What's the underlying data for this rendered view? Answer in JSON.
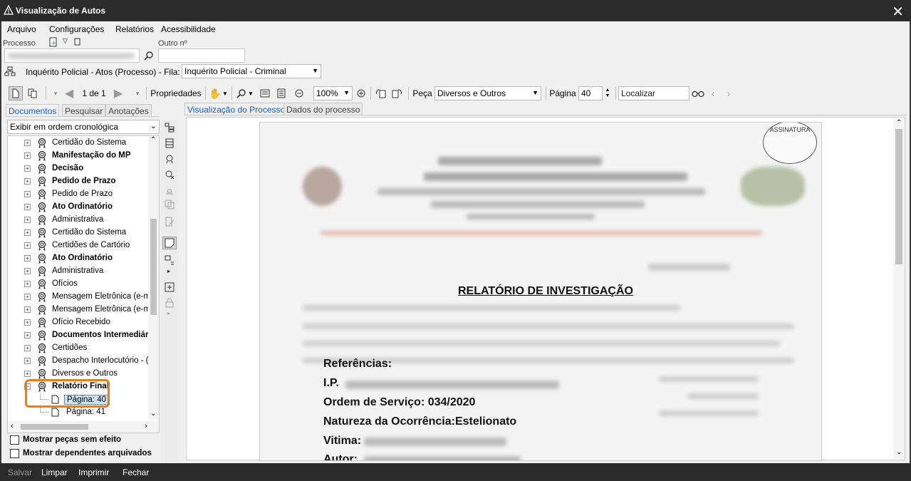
{
  "window": {
    "title": "Visualização de Autos",
    "close_glyph": "✕"
  },
  "menu": {
    "items": [
      "Arquivo",
      "Configurações",
      "Relatórios",
      "Acessibilidade"
    ]
  },
  "process": {
    "label": "Processo",
    "number": "",
    "other_label": "Outro nº",
    "other_value": ""
  },
  "queue": {
    "text": "Inquérito Policial - Atos (Processo) - Fila:",
    "selected": "Inquérito Policial - Criminal"
  },
  "toolbar": {
    "page_counter": "1 de 1",
    "properties": "Propriedades",
    "zoom": "100%",
    "piece_label": "Peça",
    "piece_value": "Diversos e Outros",
    "page_label": "Página",
    "page_value": "40",
    "search_placeholder": "Localizar"
  },
  "left_tabs": [
    "Documentos",
    "Pesquisar",
    "Anotações"
  ],
  "order_select": "Exibir em ordem cronológica",
  "tree": [
    {
      "label": "Certidão do Sistema",
      "bold": false
    },
    {
      "label": "Manifestação do MP",
      "bold": true
    },
    {
      "label": "Decisão",
      "bold": true
    },
    {
      "label": "Pedido de Prazo",
      "bold": true
    },
    {
      "label": "Pedido de Prazo",
      "bold": false
    },
    {
      "label": "Ato Ordinatório",
      "bold": true
    },
    {
      "label": "Administrativa",
      "bold": false
    },
    {
      "label": "Certidão do Sistema",
      "bold": false
    },
    {
      "label": "Certidões de Cartório",
      "bold": false
    },
    {
      "label": "Ato Ordinatório",
      "bold": true
    },
    {
      "label": "Administrativa",
      "bold": false
    },
    {
      "label": "Ofícios",
      "bold": false
    },
    {
      "label": "Mensagem Eletrônica  (e-m",
      "bold": false
    },
    {
      "label": "Mensagem Eletrônica  (e-m",
      "bold": false
    },
    {
      "label": "Ofício Recebido",
      "bold": false
    },
    {
      "label": "Documentos Intermediári",
      "bold": true
    },
    {
      "label": "Certidões",
      "bold": false
    },
    {
      "label": "Despacho Interlocutório - (",
      "bold": false
    },
    {
      "label": "Diversos e Outros",
      "bold": false
    },
    {
      "label": "Relatório Final",
      "bold": true,
      "expanded": true
    }
  ],
  "tree_children": [
    "Página: 40",
    "Página: 41"
  ],
  "checkboxes": [
    "Mostrar peças sem efeito",
    "Mostrar dependentes arquivados"
  ],
  "view_tabs": [
    "Visualização do Processo",
    "Dados do processo"
  ],
  "document": {
    "heading": "RELATÓRIO DE INVESTIGAÇÃO",
    "lines": [
      "Referências:",
      "I.P.",
      "Ordem de Serviço: 034/2020",
      "Natureza da Ocorrência:Estelionato",
      "Vitima:",
      "Autor:"
    ],
    "stamp": "ASSINATURA"
  },
  "status": {
    "save": "Salvar",
    "clear": "Limpar",
    "print": "Imprimir",
    "close": "Fechar"
  },
  "colors": {
    "titlebar": "#2b2b2b",
    "accent": "#1a5fb4",
    "highlight": "#e87d1e"
  }
}
